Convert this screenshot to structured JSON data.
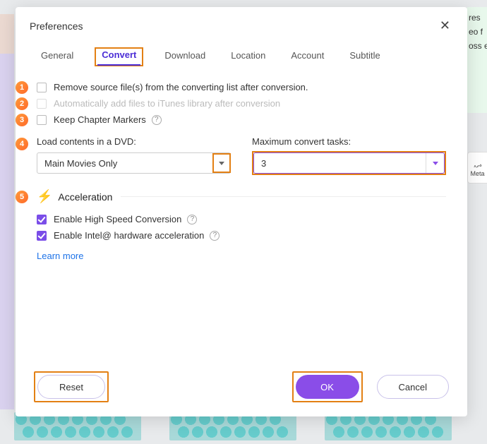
{
  "background": {
    "right_panel_lines": [
      "res",
      "eo f",
      "oss e"
    ],
    "meta_label": "Meta"
  },
  "modal": {
    "title": "Preferences",
    "tabs": [
      "General",
      "Convert",
      "Download",
      "Location",
      "Account",
      "Subtitle"
    ],
    "active_tab": "Convert",
    "opts": {
      "remove_source": "Remove source file(s) from the converting list after conversion.",
      "auto_itunes": "Automatically add files to iTunes library after conversion",
      "keep_chapters": "Keep Chapter Markers"
    },
    "dvd": {
      "label": "Load contents in a DVD:",
      "value": "Main Movies Only"
    },
    "max_tasks": {
      "label": "Maximum convert tasks:",
      "value": "3"
    },
    "accel": {
      "title": "Acceleration",
      "high_speed": "Enable High Speed Conversion",
      "intel": "Enable Intel@ hardware acceleration",
      "learn_more": "Learn more"
    },
    "buttons": {
      "reset": "Reset",
      "ok": "OK",
      "cancel": "Cancel"
    },
    "badges": [
      "1",
      "2",
      "3",
      "4",
      "5"
    ]
  }
}
